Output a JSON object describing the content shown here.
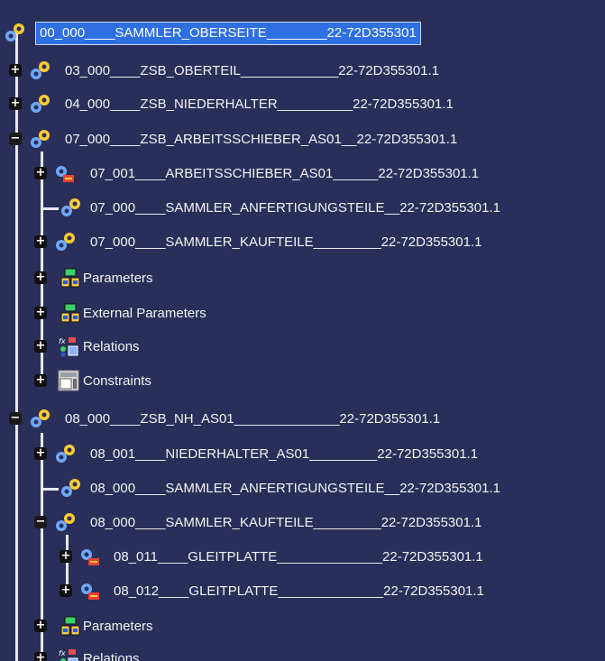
{
  "tree": {
    "root": {
      "label": "00_000____SAMMLER_OBERSEITE________22-72D355301",
      "selected": true
    },
    "nodes": [
      {
        "id": "n03",
        "label": "03_000____ZSB_OBERTEIL_____________22-72D355301.1",
        "icon": "product-icon",
        "expander": "+"
      },
      {
        "id": "n04",
        "label": "04_000____ZSB_NIEDERHALTER__________22-72D355301.1",
        "icon": "product-icon",
        "expander": "+"
      },
      {
        "id": "n07",
        "label": "07_000____ZSB_ARBEITSSCHIEBER_AS01__22-72D355301.1",
        "icon": "product-icon",
        "expander": "−"
      },
      {
        "id": "n07_001",
        "label": "07_001____ARBEITSSCHIEBER_AS01______22-72D355301.1",
        "icon": "part-icon",
        "expander": "+"
      },
      {
        "id": "n07_000a",
        "label": "07_000____SAMMLER_ANFERTIGUNGSTEILE__22-72D355301.1",
        "icon": "product-icon",
        "expander": ""
      },
      {
        "id": "n07_000b",
        "label": "07_000____SAMMLER_KAUFTEILE_________22-72D355301.1",
        "icon": "product-icon",
        "expander": "+"
      },
      {
        "id": "p1",
        "label": "Parameters",
        "icon": "parameters-icon",
        "expander": "+"
      },
      {
        "id": "ep1",
        "label": "External Parameters",
        "icon": "parameters-icon",
        "expander": "+"
      },
      {
        "id": "r1",
        "label": "Relations",
        "icon": "relations-icon",
        "expander": "+"
      },
      {
        "id": "c1",
        "label": "Constraints",
        "icon": "constraints-icon",
        "expander": "+"
      },
      {
        "id": "n08",
        "label": "08_000____ZSB_NH_AS01______________22-72D355301.1",
        "icon": "product-icon",
        "expander": "−"
      },
      {
        "id": "n08_001",
        "label": "08_001____NIEDERHALTER_AS01_________22-72D355301.1",
        "icon": "part-icon",
        "expander": "+"
      },
      {
        "id": "n08_000a",
        "label": "08_000____SAMMLER_ANFERTIGUNGSTEILE__22-72D355301.1",
        "icon": "product-icon",
        "expander": ""
      },
      {
        "id": "n08_000b",
        "label": "08_000____SAMMLER_KAUFTEILE_________22-72D355301.1",
        "icon": "product-icon",
        "expander": "−"
      },
      {
        "id": "n08_011",
        "label": "08_011____GLEITPLATTE______________22-72D355301.1",
        "icon": "part-icon",
        "expander": "+"
      },
      {
        "id": "n08_012",
        "label": "08_012____GLEITPLATTE______________22-72D355301.1",
        "icon": "part-icon",
        "expander": "+"
      },
      {
        "id": "p2",
        "label": "Parameters",
        "icon": "parameters-icon",
        "expander": "+"
      },
      {
        "id": "r2",
        "label": "Relations",
        "icon": "relations-icon",
        "expander": "+"
      }
    ]
  },
  "colors": {
    "background": "#2a2f5a",
    "text": "#f2f2f2",
    "selection": "#2e6fe2",
    "tree_lines": "#e8e8e8"
  }
}
